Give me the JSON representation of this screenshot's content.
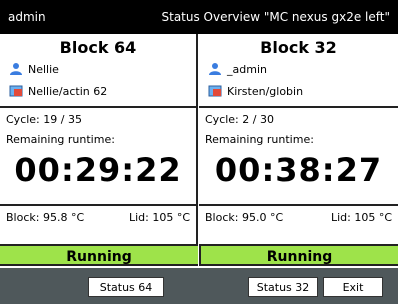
{
  "topbar": {
    "user": "admin",
    "status": "Status Overview \"MC nexus gx2e left\""
  },
  "panels": [
    {
      "title": "Block 64",
      "user": "Nellie",
      "file": "Nellie/actin 62",
      "cycle": "Cycle: 19 / 35",
      "remaining_label": "Remaining runtime:",
      "runtime": "00:29:22",
      "block_temp": "Block: 95.8 °C",
      "lid_temp": "Lid: 105 °C",
      "state": "Running"
    },
    {
      "title": "Block 32",
      "user": "_admin",
      "file": "Kirsten/globin",
      "cycle": "Cycle: 2 / 30",
      "remaining_label": "Remaining runtime:",
      "runtime": "00:38:27",
      "block_temp": "Block: 95.0 °C",
      "lid_temp": "Lid: 105 °C",
      "state": "Running"
    }
  ],
  "buttons": {
    "status64": "Status 64",
    "status32": "Status 32",
    "exit": "Exit"
  },
  "colors": {
    "running_green": "#9ee34a",
    "footer_gray": "#4f585b",
    "user_icon_blue": "#3a7de0"
  }
}
